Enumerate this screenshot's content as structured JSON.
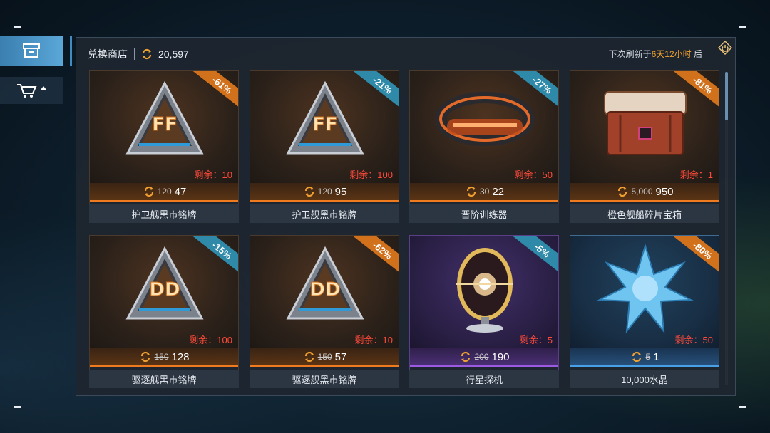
{
  "shop": {
    "title": "兑换商店",
    "balance": "20,597",
    "refresh": {
      "prefix": "下次刷新于",
      "days": "6天",
      "hours": "12小时",
      "suffix": "后"
    }
  },
  "colors": {
    "accent_orange": "#f07a1e",
    "accent_purple": "#9c5ae0",
    "accent_blue": "#48a0e6",
    "stock_red": "#ff4a3a"
  },
  "sidebar": {
    "tabs": [
      {
        "icon": "store-icon",
        "active": true
      },
      {
        "icon": "cart-icon",
        "active": false
      }
    ]
  },
  "items": [
    {
      "name": "护卫舰黑市铭牌",
      "discount": "-61%",
      "stock": "剩余：10",
      "old_price": "120",
      "price": "47",
      "rarity": "orange",
      "ribbon": "orange",
      "icon": "ff-badge-icon"
    },
    {
      "name": "护卫舰黑市铭牌",
      "discount": "-21%",
      "stock": "剩余：100",
      "old_price": "120",
      "price": "95",
      "rarity": "orange",
      "ribbon": "teal",
      "icon": "ff-badge-icon"
    },
    {
      "name": "晋阶训练器",
      "discount": "-27%",
      "stock": "剩余：50",
      "old_price": "30",
      "price": "22",
      "rarity": "orange",
      "ribbon": "teal",
      "icon": "trainer-ring-icon"
    },
    {
      "name": "橙色舰船碎片宝箱",
      "discount": "-81%",
      "stock": "剩余：1",
      "old_price": "5,000",
      "price": "950",
      "rarity": "orange",
      "ribbon": "orange",
      "icon": "chest-icon"
    },
    {
      "name": "驱逐舰黑市铭牌",
      "discount": "-15%",
      "stock": "剩余：100",
      "old_price": "150",
      "price": "128",
      "rarity": "orange",
      "ribbon": "teal",
      "icon": "dd-badge-icon"
    },
    {
      "name": "驱逐舰黑市铭牌",
      "discount": "-62%",
      "stock": "剩余：10",
      "old_price": "150",
      "price": "57",
      "rarity": "orange",
      "ribbon": "orange",
      "icon": "dd-badge-icon"
    },
    {
      "name": "行星探机",
      "discount": "-5%",
      "stock": "剩余：5",
      "old_price": "200",
      "price": "190",
      "rarity": "purple",
      "ribbon": "teal",
      "icon": "planet-probe-icon"
    },
    {
      "name": "10,000水晶",
      "discount": "-80%",
      "stock": "剩余：50",
      "old_price": "5",
      "price": "1",
      "rarity": "blue",
      "ribbon": "orange",
      "icon": "crystal-icon"
    }
  ]
}
